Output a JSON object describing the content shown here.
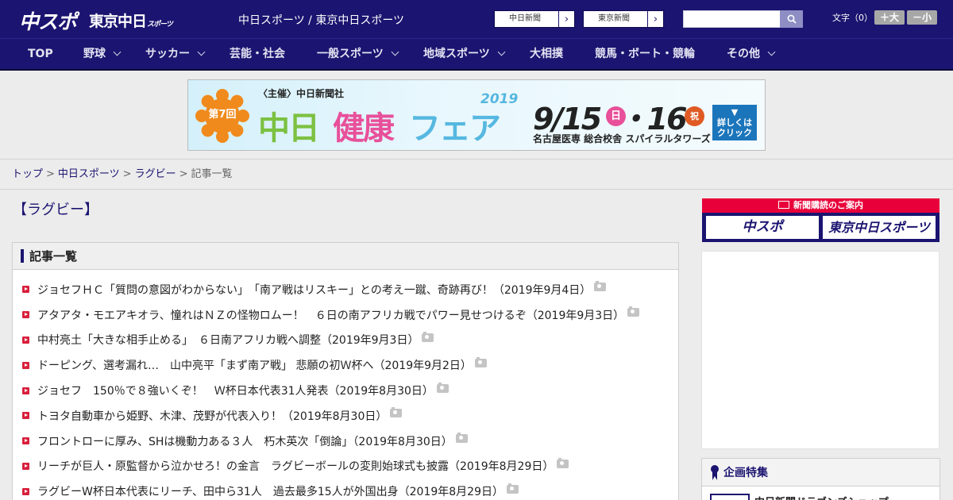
{
  "header": {
    "logo_main": "中スポ",
    "logo_sub": "東京中日",
    "logo_sub_small": "スポーツ",
    "site_title": "中日スポーツ / 東京中日スポーツ",
    "paper_links": [
      {
        "label": "中日新聞"
      },
      {
        "label": "東京新聞"
      }
    ],
    "search": {
      "placeholder": "",
      "icon": "search-icon"
    },
    "font_size": {
      "label": "文字（0）",
      "larger": "＋大",
      "smaller": "－小"
    }
  },
  "nav": [
    {
      "label": "TOP",
      "has_dropdown": false
    },
    {
      "label": "野球",
      "has_dropdown": true
    },
    {
      "label": "サッカー",
      "has_dropdown": true
    },
    {
      "label": "芸能・社会",
      "has_dropdown": false
    },
    {
      "label": "一般スポーツ",
      "has_dropdown": true
    },
    {
      "label": "地域スポーツ",
      "has_dropdown": true
    },
    {
      "label": "大相撲",
      "has_dropdown": false
    },
    {
      "label": "競馬・ボート・競輪",
      "has_dropdown": false
    },
    {
      "label": "その他",
      "has_dropdown": true
    }
  ],
  "banner": {
    "organizer": "〈主催〉中日新聞社",
    "round": "第7回",
    "title_a": "中日",
    "title_b": "健康",
    "title_c": "フェア",
    "year": "2019",
    "dates": "9/15  ・16",
    "day1": "日",
    "day2": "祝",
    "venue": "名古屋医専 総合校舎 スパイラルタワーズ",
    "cta": "▼\n詳しくは\nクリック"
  },
  "breadcrumb": [
    {
      "label": "トップ"
    },
    {
      "label": "中日スポーツ"
    },
    {
      "label": "ラグビー"
    },
    {
      "label": "記事一覧"
    }
  ],
  "page_heading": "【ラグビー】",
  "article_list": {
    "title": "記事一覧",
    "items": [
      {
        "text": "ジョセフＨＣ「質問の意図がわからない」　「南ア戦はリスキー」との考え一蹴、奇跡再び！（2019年9月4日）"
      },
      {
        "text": "アタアタ・モエアキオラ、憧れはＮＺの怪物ロムー！　６日の南アフリカ戦でパワー見せつけるぞ（2019年9月3日）"
      },
      {
        "text": "中村亮土「大きな相手止める」　６日南アフリカ戦へ調整（2019年9月3日）"
      },
      {
        "text": "ドーピング、選考漏れ…　山中亮平「まず南ア戦」 悲願の初Ｗ杯へ（2019年9月2日）"
      },
      {
        "text": "ジョセフ　150％で８強いくぞ！　Ｗ杯日本代表31人発表（2019年8月30日）"
      },
      {
        "text": "トヨタ自動車から姫野、木津、茂野が代表入り！（2019年8月30日）"
      },
      {
        "text": "フロントローに厚み、SHは機動力ある３人　朽木英次「倒論」（2019年8月30日）"
      },
      {
        "text": "リーチが巨人・原監督から泣かせろ！の金言　ラグビーボールの変則始球式も披露（2019年8月29日）"
      },
      {
        "text": "ラグビーW杯日本代表にリーチ、田中ら31人　過去最多15人が外国出身（2019年8月29日）"
      }
    ]
  },
  "sidebar": {
    "subscribe_title": "新聞購読のご案内",
    "subscribe_logos": [
      "中スポ",
      "東京中日スポーツ"
    ],
    "feature_title": "企画特集",
    "feature_item": "中日新聞ドラゴンズショップ"
  },
  "colors": {
    "brand_navy": "#1b1470",
    "accent_red": "#d8203c",
    "subscribe_red": "#e8003a"
  }
}
